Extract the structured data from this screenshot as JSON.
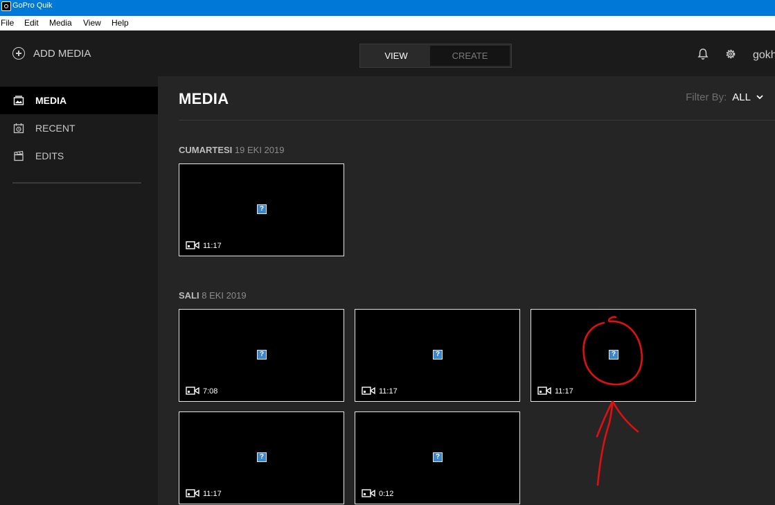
{
  "window": {
    "title": "GoPro Quik",
    "icon": "gopro-app-icon"
  },
  "menu": [
    "File",
    "Edit",
    "Media",
    "View",
    "Help"
  ],
  "header": {
    "add_media_label": "ADD MEDIA",
    "tabs": [
      {
        "label": "VIEW",
        "active": true
      },
      {
        "label": "CREATE",
        "active": false
      }
    ],
    "user": "gokh"
  },
  "sidebar": {
    "items": [
      {
        "label": "MEDIA",
        "icon": "media-icon",
        "active": true
      },
      {
        "label": "RECENT",
        "icon": "recent-icon",
        "active": false
      },
      {
        "label": "EDITS",
        "icon": "edits-icon",
        "active": false
      }
    ]
  },
  "main": {
    "title": "MEDIA",
    "filter": {
      "label": "Filter By:",
      "value": "ALL"
    },
    "groups": [
      {
        "day": "CUMARTESI",
        "date": "19 EKI 2019",
        "items": [
          {
            "duration": "11:17"
          }
        ]
      },
      {
        "day": "SALI",
        "date": "8 EKI 2019",
        "items": [
          {
            "duration": "7:08"
          },
          {
            "duration": "11:17"
          },
          {
            "duration": "11:17"
          },
          {
            "duration": "11:17"
          },
          {
            "duration": "0:12"
          }
        ]
      }
    ],
    "placeholder_glyph": "?"
  },
  "colors": {
    "titlebar": "#0078d7",
    "background": "#1b1b1b",
    "main_panel": "#252525",
    "annotation": "#e01010"
  }
}
